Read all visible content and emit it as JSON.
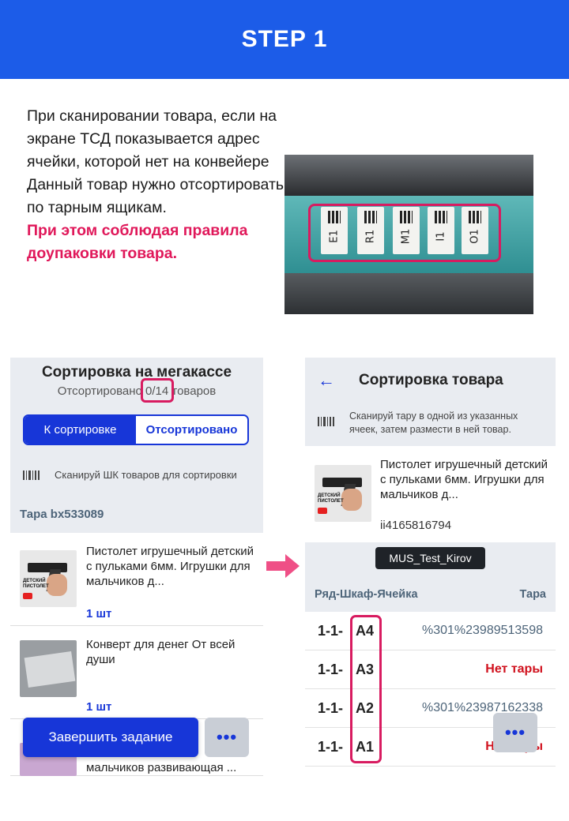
{
  "banner": {
    "title": "STEP 1"
  },
  "intro": {
    "line1": "При сканировании товара, если на экране ТСД показывается адрес ячейки, которой нет на конвейере",
    "line2": "Данный товар нужно отсортировать по тарным ящикам.",
    "warning": "При этом соблюдая правила доупаковки товара."
  },
  "photo": {
    "labels": [
      "E1",
      "R1",
      "M1",
      "I1",
      "O1"
    ]
  },
  "left_screen": {
    "title": "Сортировка на мегакассе",
    "subtitle_prefix": "Отсортировано ",
    "subtitle_count": "0/14",
    "subtitle_suffix": " товаров",
    "tabs": [
      "К сортировке",
      "Отсортировано"
    ],
    "scan_hint": "Сканируй ШК товаров для сортировки",
    "tara": "Тара bx533089",
    "items": [
      {
        "name": "Пистолет игрушечный детский с пульками 6мм. Игрушки для мальчиков д...",
        "qty": "1 шт"
      },
      {
        "name": "Конверт для денег От всей души",
        "qty": "1 шт"
      },
      {
        "name": "мальчиков развивающая ..."
      }
    ],
    "finish_label": "Завершить задание",
    "more_label": "•••",
    "gun_tag": "ДЕТСКИЙ ПИСТОЛЕТ"
  },
  "right_screen": {
    "title": "Сортировка товара",
    "back": "←",
    "scan_hint": "Сканируй тару в одной из указанных ячеек, затем размести в ней товар.",
    "product_name": "Пистолет игрушечный детский с пульками 6мм. Игрушки для мальчиков д...",
    "product_id": "ii4165816794",
    "chip": "MUS_Test_Kirov",
    "col_cell": "Ряд-Шкаф-Ячейка",
    "col_tara": "Тара",
    "rows": [
      {
        "prefix": "1-1-",
        "code": "A4",
        "tara": "%301%23989513598"
      },
      {
        "prefix": "1-1-",
        "code": "A3",
        "tara": "Нет тары"
      },
      {
        "prefix": "1-1-",
        "code": "A2",
        "tara": "%301%23987162338"
      },
      {
        "prefix": "1-1-",
        "code": "A1",
        "tara": "Нет тары"
      }
    ],
    "more_label": "•••"
  },
  "colors": {
    "brand_blue": "#1c5ce8",
    "accent_pink": "#d81b60",
    "tab_blue": "#1736d8",
    "error_red": "#d0101c"
  }
}
